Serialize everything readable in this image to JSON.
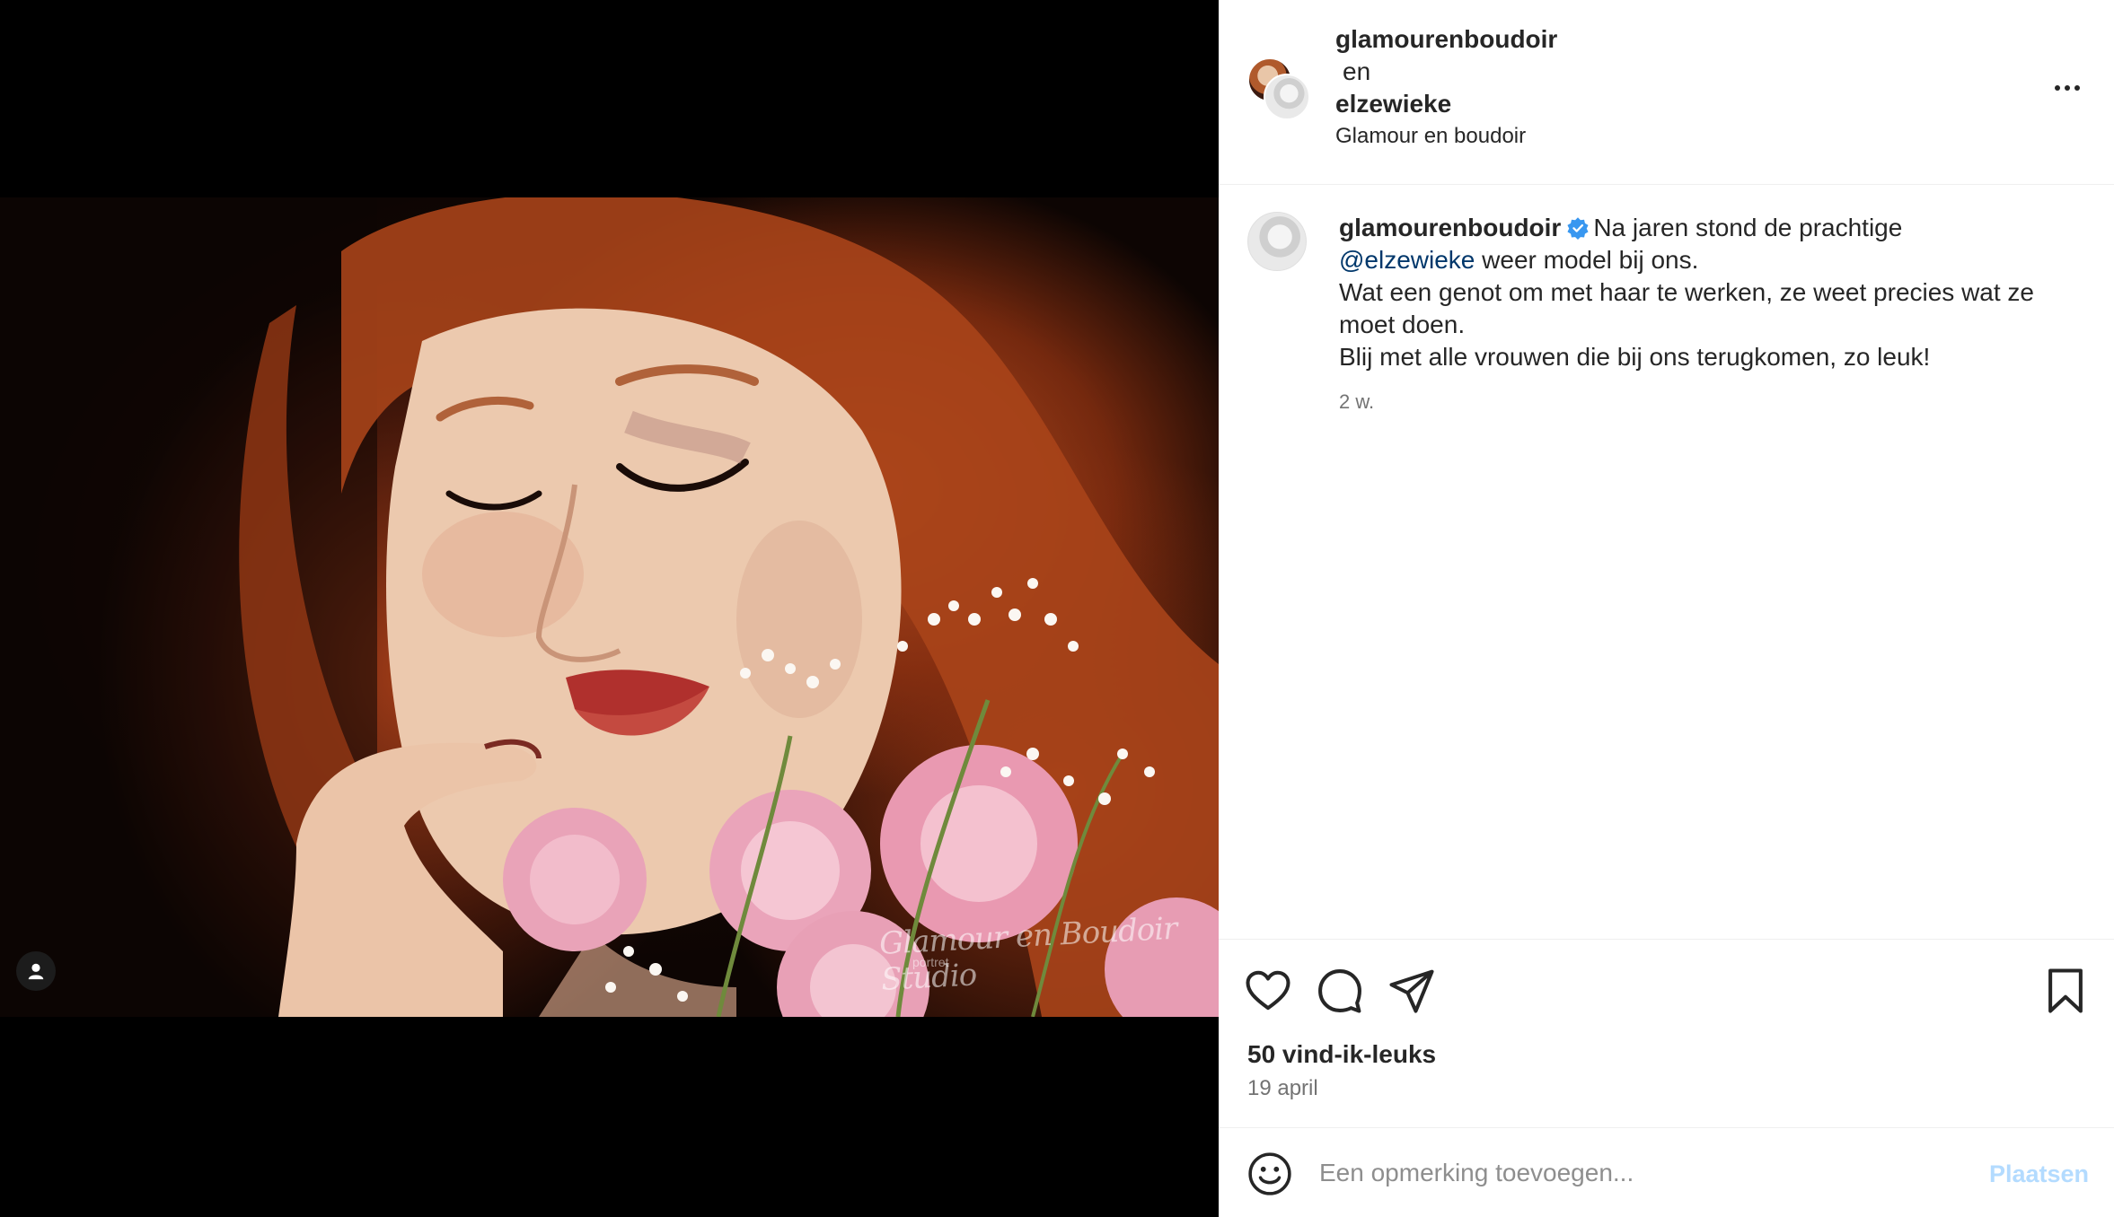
{
  "post": {
    "header": {
      "user1": "glamourenboudoir",
      "joiner": "en",
      "user2": "elzewieke",
      "location": "Glamour en boudoir"
    },
    "media": {
      "watermark": "Glamour en Boudoir Studio",
      "watermark_sub": "portret",
      "tag_icon": "user-tag-icon"
    },
    "caption": {
      "user": "glamourenboudoir",
      "verified": true,
      "text_before_mention": "Na jaren stond de prachtige",
      "mention": "@elzewieke",
      "text_after_mention": "weer model bij ons.",
      "line2": "Wat een genot om met haar te werken, ze weet precies wat ze moet doen.",
      "line3": "Blij met alle vrouwen die bij ons terugkomen, zo leuk!",
      "time": "2 w."
    },
    "actions": {
      "like_icon": "heart-icon",
      "comment_icon": "comment-icon",
      "share_icon": "send-icon",
      "save_icon": "bookmark-icon"
    },
    "likes": "50 vind-ik-leuks",
    "date": "19 april",
    "comment": {
      "placeholder": "Een opmerking toevoegen...",
      "post_label": "Plaatsen",
      "emoji_icon": "emoji-icon"
    }
  },
  "colors": {
    "verified": "#3897f0",
    "mention": "#00376b",
    "post_button_disabled": "#b3dbff",
    "muted_text": "#737373"
  }
}
